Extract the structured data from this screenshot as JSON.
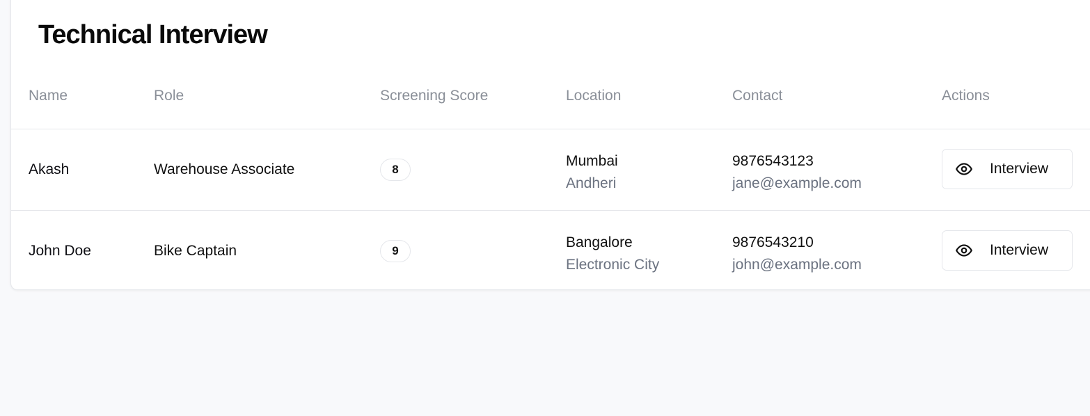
{
  "page": {
    "title": "Technical Interview"
  },
  "table": {
    "headers": [
      "Name",
      "Role",
      "Screening Score",
      "Location",
      "Contact",
      "Actions"
    ],
    "rows": [
      {
        "name": "Akash",
        "role": "Warehouse Associate",
        "score": "8",
        "city": "Mumbai",
        "area": "Andheri",
        "phone": "9876543123",
        "email": "jane@example.com",
        "action_label": "Interview",
        "action_icon": "eye-icon"
      },
      {
        "name": "John Doe",
        "role": "Bike Captain",
        "score": "9",
        "city": "Bangalore",
        "area": "Electronic City",
        "phone": "9876543210",
        "email": "john@example.com",
        "action_label": "Interview",
        "action_icon": "eye-icon"
      }
    ]
  },
  "colors": {
    "background": "#f8f9fb",
    "card": "#ffffff",
    "border": "#e5e7eb",
    "header_text": "#8a8f98",
    "secondary_text": "#6b7280"
  }
}
